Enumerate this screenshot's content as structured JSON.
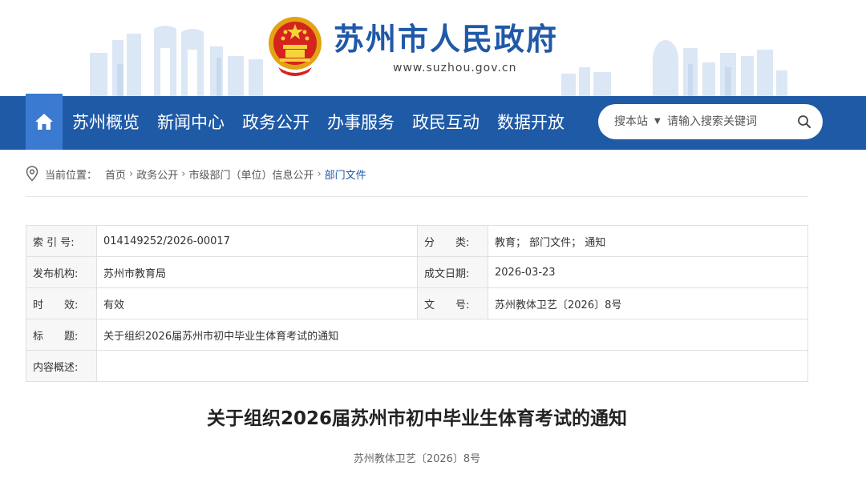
{
  "header": {
    "site_title": "苏州市人民政府",
    "site_url": "www.suzhou.gov.cn"
  },
  "nav": {
    "items": [
      "苏州概览",
      "新闻中心",
      "政务公开",
      "办事服务",
      "政民互动",
      "数据开放"
    ],
    "search_scope": "搜本站",
    "search_placeholder": "请输入搜索关键词"
  },
  "breadcrumb": {
    "prefix": "当前位置：",
    "items": [
      "首页",
      "政务公开",
      "市级部门（单位）信息公开",
      "部门文件"
    ]
  },
  "info": {
    "index_label": "索 引 号:",
    "index_value": "014149252/2026-00017",
    "category_label": "分　　类:",
    "category_value": "教育；  部门文件；  通知",
    "publisher_label": "发布机构:",
    "publisher_value": "苏州市教育局",
    "date_label": "成文日期:",
    "date_value": "2026-03-23",
    "validity_label": "时　　效:",
    "validity_value": "有效",
    "docno_label": "文　　号:",
    "docno_value": "苏州教体卫艺〔2026〕8号",
    "title_label": "标　　题:",
    "title_value": "关于组织2026届苏州市初中毕业生体育考试的通知",
    "summary_label": "内容概述:",
    "summary_value": ""
  },
  "article": {
    "title": "关于组织2026届苏州市初中毕业生体育考试的通知",
    "doc_no": "苏州教体卫艺〔2026〕8号"
  },
  "colors": {
    "nav_bg": "#1f5aa6",
    "home_bg": "#3b7ad1",
    "brand": "#1f59a8"
  }
}
